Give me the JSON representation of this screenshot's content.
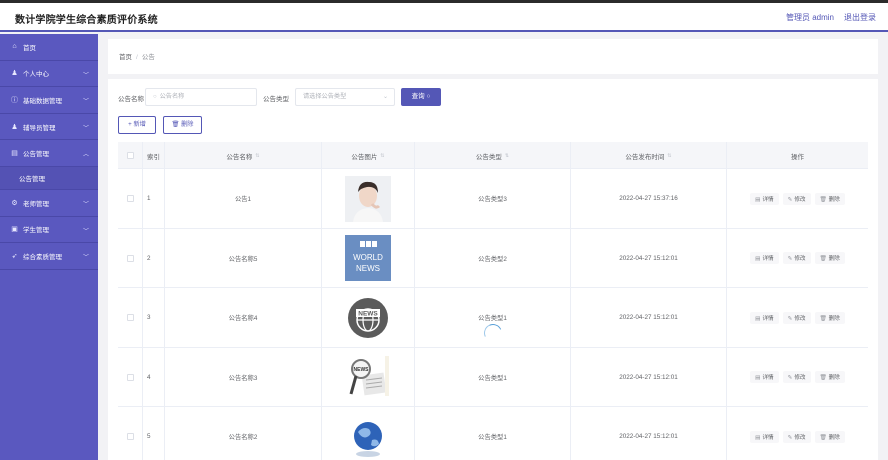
{
  "header": {
    "title": "数计学院学生综合素质评价系统",
    "admin_label": "管理员 admin",
    "logout_label": "退出登录"
  },
  "sidebar": {
    "items": [
      {
        "label": "首页",
        "icon": "home-icon",
        "glyph": "⌂",
        "expandable": false
      },
      {
        "label": "个人中心",
        "icon": "user-icon",
        "glyph": "♟",
        "expandable": true
      },
      {
        "label": "基础数据管理",
        "icon": "info-icon",
        "glyph": "ⓘ",
        "expandable": true
      },
      {
        "label": "辅导员管理",
        "icon": "user-icon",
        "glyph": "♟",
        "expandable": true
      },
      {
        "label": "公告管理",
        "icon": "notice-icon",
        "glyph": "▤",
        "expandable": true,
        "expanded": true
      },
      {
        "label": "老师管理",
        "icon": "settings-icon",
        "glyph": "⚙",
        "expandable": true
      },
      {
        "label": "学生管理",
        "icon": "document-icon",
        "glyph": "▣",
        "expandable": true
      },
      {
        "label": "综合素质管理",
        "icon": "send-icon",
        "glyph": "➶",
        "expandable": true
      }
    ],
    "submenu_label": "公告管理"
  },
  "breadcrumb": {
    "home": "首页",
    "separator": "/",
    "current": "公告"
  },
  "search": {
    "name_label": "公告名称",
    "name_placeholder": "公告名称",
    "type_label": "公告类型",
    "type_placeholder": "请选择公告类型",
    "query_label": "查询"
  },
  "actions": {
    "add_label": "新增",
    "delete_label": "删除"
  },
  "table": {
    "headers": {
      "index": "索引",
      "name": "公告名称",
      "image": "公告图片",
      "type": "公告类型",
      "time": "公告发布时间",
      "ops": "操作"
    },
    "op_labels": {
      "detail": "详情",
      "edit": "修改",
      "delete": "删除"
    },
    "rows": [
      {
        "index": "1",
        "name": "公告1",
        "type": "公告类型3",
        "time": "2022-04-27 15:37:16",
        "image": "portrait"
      },
      {
        "index": "2",
        "name": "公告名称5",
        "type": "公告类型2",
        "time": "2022-04-27 15:12:01",
        "image": "bbc-world-news",
        "image_text": [
          "BBC",
          "WORLD",
          "NEWS"
        ]
      },
      {
        "index": "3",
        "name": "公告名称4",
        "type": "公告类型1",
        "time": "2022-04-27 15:12:01",
        "image": "news-globe-badge",
        "image_text": [
          "NEWS"
        ]
      },
      {
        "index": "4",
        "name": "公告名称3",
        "type": "公告类型1",
        "time": "2022-04-27 15:12:01",
        "image": "magnifier-newspaper",
        "image_text": [
          "NEWS"
        ]
      },
      {
        "index": "5",
        "name": "公告名称2",
        "type": "公告类型1",
        "time": "2022-04-27 15:12:01",
        "image": "blue-globe"
      }
    ]
  },
  "colors": {
    "accent": "#5457b6",
    "sidebar": "#5a58bf",
    "bbc_blue": "#6a8ec2"
  }
}
